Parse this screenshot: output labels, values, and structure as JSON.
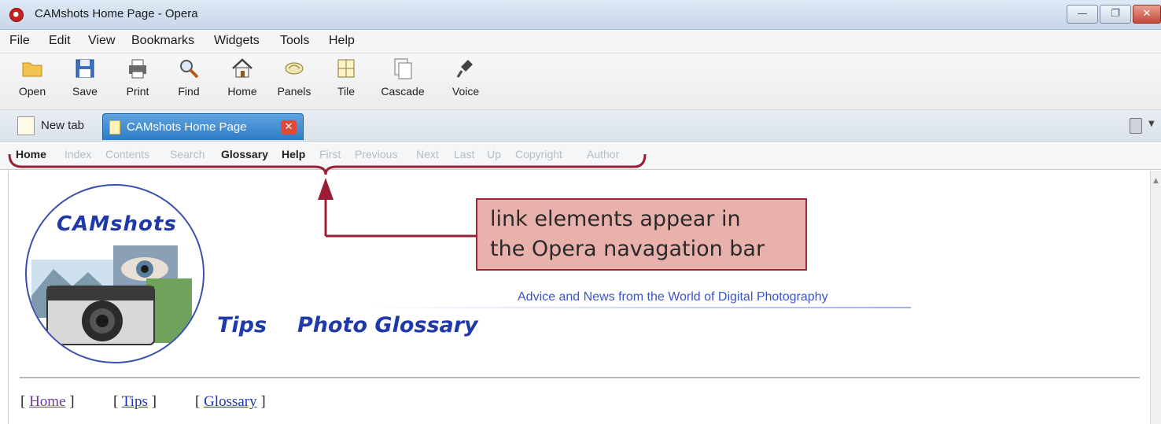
{
  "window": {
    "title": "CAMshots Home Page - Opera"
  },
  "menu": [
    "File",
    "Edit",
    "View",
    "Bookmarks",
    "Widgets",
    "Tools",
    "Help"
  ],
  "toolbar": {
    "open": "Open",
    "save": "Save",
    "print": "Print",
    "find": "Find",
    "home": "Home",
    "panels": "Panels",
    "tile": "Tile",
    "cascade": "Cascade",
    "voice": "Voice"
  },
  "tabs": {
    "new_tab": "New tab",
    "active": "CAMshots Home Page"
  },
  "nav_links": {
    "home": "Home",
    "index": "Index",
    "contents": "Contents",
    "search": "Search",
    "glossary": "Glossary",
    "help": "Help",
    "first": "First",
    "previous": "Previous",
    "next": "Next",
    "last": "Last",
    "up": "Up",
    "copyright": "Copyright",
    "author": "Author"
  },
  "callout": {
    "line1": "link elements appear in",
    "line2": "the Opera navagation bar"
  },
  "page": {
    "logo": "CAMshots",
    "tagline": "Advice and News from the World of Digital Photography",
    "link_tips": "Tips",
    "link_glossary": "Photo Glossary",
    "bottom": {
      "home": "Home",
      "tips": "Tips",
      "glossary": "Glossary"
    }
  },
  "colors": {
    "accent": "#1f3aa8",
    "tab_active": "#2f7cc6",
    "callout_bg": "#e9b1ab",
    "callout_border": "#a0243a"
  }
}
